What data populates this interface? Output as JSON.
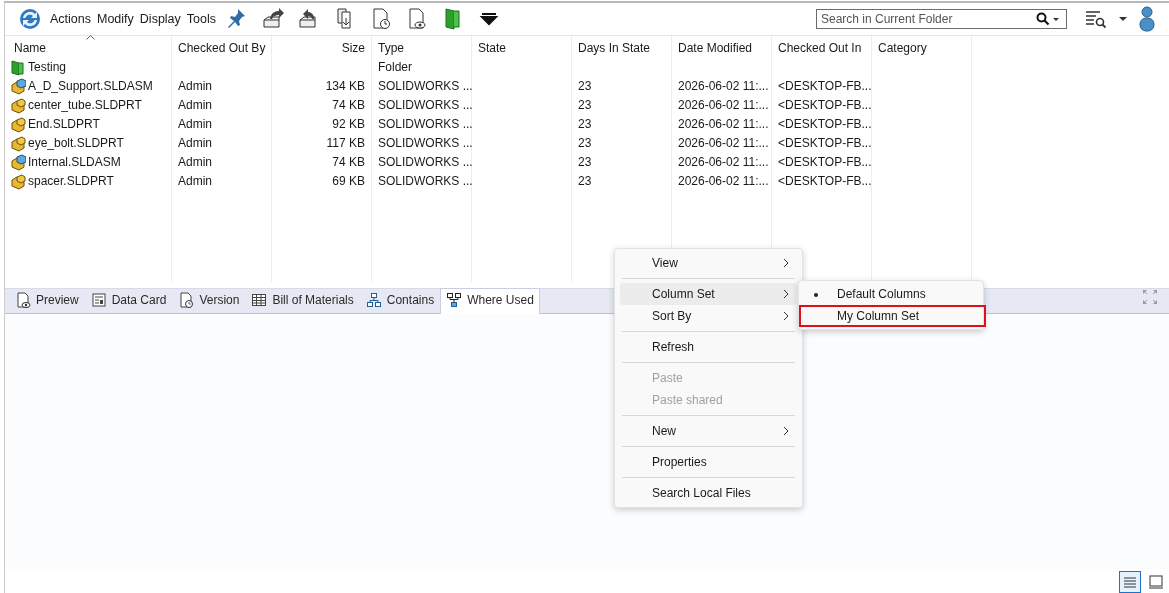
{
  "toolbar": {
    "menus": [
      "Actions",
      "Modify",
      "Display",
      "Tools"
    ],
    "search": {
      "placeholder": "Search in Current Folder"
    }
  },
  "table": {
    "columns": [
      {
        "label": "Name",
        "sorted": true,
        "kind": "text"
      },
      {
        "label": "Checked Out By",
        "sorted": false,
        "kind": "text"
      },
      {
        "label": "Size",
        "sorted": false,
        "kind": "number"
      },
      {
        "label": "Type",
        "sorted": false,
        "kind": "text"
      },
      {
        "label": "State",
        "sorted": false,
        "kind": "text"
      },
      {
        "label": "Days In State",
        "sorted": false,
        "kind": "text"
      },
      {
        "label": "Date Modified",
        "sorted": false,
        "kind": "text"
      },
      {
        "label": "Checked Out In",
        "sorted": false,
        "kind": "text"
      },
      {
        "label": "Category",
        "sorted": false,
        "kind": "text"
      }
    ],
    "rows": [
      {
        "kind": "folder",
        "cells": [
          "Testing",
          "",
          "",
          "Folder",
          "",
          "",
          "",
          "",
          ""
        ]
      },
      {
        "kind": "assembly",
        "cells": [
          "A_D_Support.SLDASM",
          "Admin",
          "134 KB",
          "SOLIDWORKS ...",
          "",
          "23",
          "2026-06-02 11:...",
          "<DESKTOP-FB...",
          ""
        ]
      },
      {
        "kind": "part",
        "cells": [
          "center_tube.SLDPRT",
          "Admin",
          "74 KB",
          "SOLIDWORKS ...",
          "",
          "23",
          "2026-06-02 11:...",
          "<DESKTOP-FB...",
          ""
        ]
      },
      {
        "kind": "part",
        "cells": [
          "End.SLDPRT",
          "Admin",
          "92 KB",
          "SOLIDWORKS ...",
          "",
          "23",
          "2026-06-02 11:...",
          "<DESKTOP-FB...",
          ""
        ]
      },
      {
        "kind": "part",
        "cells": [
          "eye_bolt.SLDPRT",
          "Admin",
          "117 KB",
          "SOLIDWORKS ...",
          "",
          "23",
          "2026-06-02 11:...",
          "<DESKTOP-FB...",
          ""
        ]
      },
      {
        "kind": "assembly",
        "cells": [
          "Internal.SLDASM",
          "Admin",
          "74 KB",
          "SOLIDWORKS ...",
          "",
          "23",
          "2026-06-02 11:...",
          "<DESKTOP-FB...",
          ""
        ]
      },
      {
        "kind": "part",
        "cells": [
          "spacer.SLDPRT",
          "Admin",
          "69 KB",
          "SOLIDWORKS ...",
          "",
          "23",
          "2026-06-02 11:...",
          "<DESKTOP-FB...",
          ""
        ]
      }
    ]
  },
  "tabs": [
    {
      "label": "Preview",
      "selected": false
    },
    {
      "label": "Data Card",
      "selected": false
    },
    {
      "label": "Version",
      "selected": false
    },
    {
      "label": "Bill of Materials",
      "selected": false
    },
    {
      "label": "Contains",
      "selected": false
    },
    {
      "label": "Where Used",
      "selected": true
    }
  ],
  "context_menu": {
    "groups": [
      [
        {
          "label": "View",
          "submenu": true,
          "hovered": false,
          "disabled": false
        }
      ],
      [
        {
          "label": "Column Set",
          "submenu": true,
          "hovered": true,
          "disabled": false
        },
        {
          "label": "Sort By",
          "submenu": true,
          "hovered": false,
          "disabled": false
        }
      ],
      [
        {
          "label": "Refresh",
          "submenu": false,
          "hovered": false,
          "disabled": false
        }
      ],
      [
        {
          "label": "Paste",
          "submenu": false,
          "hovered": false,
          "disabled": true
        },
        {
          "label": "Paste shared",
          "submenu": false,
          "hovered": false,
          "disabled": true
        }
      ],
      [
        {
          "label": "New",
          "submenu": true,
          "hovered": false,
          "disabled": false
        }
      ],
      [
        {
          "label": "Properties",
          "submenu": false,
          "hovered": false,
          "disabled": false
        }
      ],
      [
        {
          "label": "Search Local Files",
          "submenu": false,
          "hovered": false,
          "disabled": false
        }
      ]
    ],
    "submenu": [
      {
        "label": "Default Columns",
        "selected": true,
        "highlighted": false
      },
      {
        "label": "My Column Set",
        "selected": false,
        "highlighted": true
      }
    ]
  },
  "status_bar": {
    "views": [
      {
        "selected": true
      },
      {
        "selected": false
      }
    ]
  }
}
